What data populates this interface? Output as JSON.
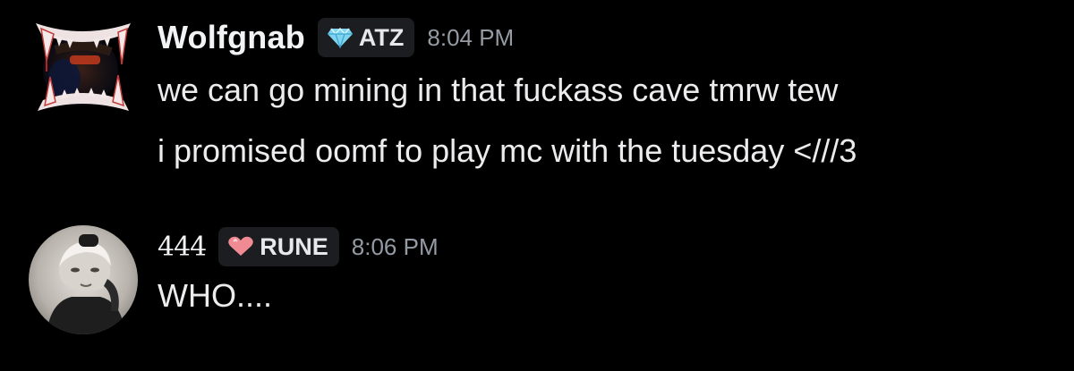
{
  "messages": [
    {
      "username": "Wolfgnab",
      "tag": {
        "icon": "diamond-icon",
        "label": "ATZ"
      },
      "timestamp": "8:04 PM",
      "lines": [
        "we can go mining in that fuckass cave tmrw tew",
        "i promised oomf to play mc with the tuesday <///3"
      ]
    },
    {
      "username": "444",
      "tag": {
        "icon": "heart-icon",
        "label": "RUNE"
      },
      "timestamp": "8:06 PM",
      "lines": [
        "WHO...."
      ]
    }
  ],
  "colors": {
    "background": "#000000",
    "username": "#f2f3f5",
    "timestamp": "#949ba4",
    "message_text": "#ececee",
    "tag_background": "#1c1d21",
    "diamond": "#7fd4f0",
    "heart": "#f08a93"
  }
}
